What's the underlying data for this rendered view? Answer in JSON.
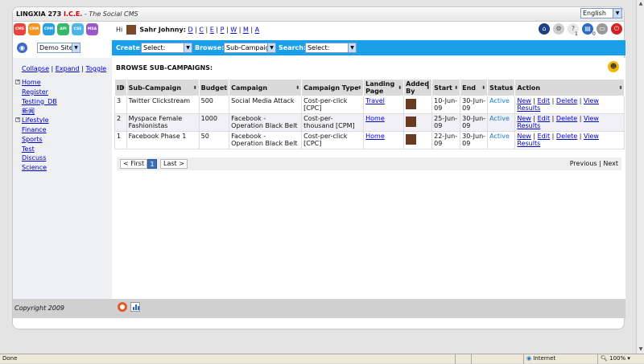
{
  "header": {
    "brand_main": "LINGXIA 273",
    "brand_ice": "I.C.E.",
    "brand_tag": " - The Social CMS",
    "language": "English"
  },
  "modules": [
    {
      "label": "CMS",
      "color": "#e8453c"
    },
    {
      "label": "CRM",
      "color": "#f39423"
    },
    {
      "label": "CPM",
      "color": "#2aa0e0"
    },
    {
      "label": "API",
      "color": "#36b86a"
    },
    {
      "label": "CSS",
      "color": "#49b6e8"
    },
    {
      "label": "MSA",
      "color": "#9a58c8"
    }
  ],
  "user": {
    "greeting": "Hi",
    "name": "Sahr Johnny:",
    "letters": [
      "D",
      "C",
      "E",
      "P",
      "W",
      "M",
      "A"
    ]
  },
  "toolbar_icons": [
    "home-icon",
    "settings-icon",
    "help-icon",
    "notes-icon",
    "print-icon",
    "power-icon"
  ],
  "toolbar_counts": {
    "help": "1",
    "notes": "0"
  },
  "site_select": "Demo Site",
  "bluebar": {
    "create_label": "Create:",
    "create_value": "Select:",
    "browse_label": "Browse:",
    "browse_value": "Sub-Campaign",
    "search_label": "Search:",
    "search_value": "Select:"
  },
  "sidebar": {
    "collapse": "Collapse",
    "expand": "Expand",
    "toggle": "Toggle",
    "items": [
      "Home",
      "Register",
      "Testing_DB",
      "新闻",
      "Lifestyle",
      "Finance",
      "Sports",
      "Test",
      "Discuss",
      "Science"
    ]
  },
  "main": {
    "title": "BROWSE SUB-CAMPAIGNS:",
    "columns": [
      "ID",
      "Sub-Campaign",
      "Budget",
      "Campaign",
      "Campaign Type",
      "Landing Page",
      "Added By",
      "Start",
      "End",
      "Status",
      "Action"
    ],
    "rows": [
      {
        "id": "3",
        "sub": "Twitter Clickstream",
        "budget": "500",
        "campaign": "Social Media Attack",
        "type": "Cost-per-click [CPC]",
        "landing": "Travel",
        "start": "10-Jun-09",
        "end": "30-Jun-09",
        "status": "Active"
      },
      {
        "id": "2",
        "sub": "Myspace Female Fashionistas",
        "budget": "1000",
        "campaign": "Facebook - Operation Black Belt",
        "type": "Cost-per-thousand [CPM]",
        "landing": "Home",
        "start": "25-Jun-09",
        "end": "30-Jun-09",
        "status": "Active"
      },
      {
        "id": "1",
        "sub": "Facebook Phase 1",
        "budget": "50",
        "campaign": "Facebook - Operation Black Belt",
        "type": "Cost-per-click [CPC]",
        "landing": "Home",
        "start": "22-Jun-09",
        "end": "30-Jun-09",
        "status": "Active"
      }
    ],
    "actions": [
      "New",
      "Edit",
      "Delete",
      "View Results"
    ]
  },
  "pager": {
    "first": "< First",
    "current": "1",
    "last": "Last >",
    "previous": "Previous",
    "separator": "|",
    "next": "Next"
  },
  "footer": {
    "copyright": "Copyright 2009"
  },
  "statusbar": {
    "left": "Done",
    "zone": "Internet",
    "zoom": "100%"
  }
}
